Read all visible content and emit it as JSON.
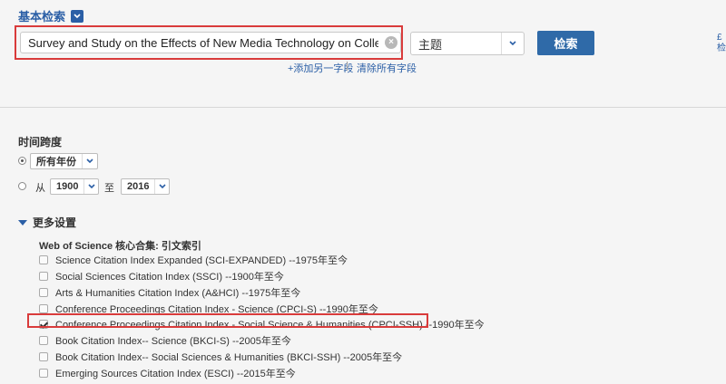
{
  "header": {
    "basic_search_label": "基本检索"
  },
  "search": {
    "query_value": "Survey and Study on the Effects of New Media Technology on College Studen",
    "field_selected": "主题",
    "search_button_label": "检索",
    "add_field_link": "+添加另一字段",
    "clear_fields_link": "清除所有字段",
    "right_edge_text": "£\n检"
  },
  "timespan": {
    "title": "时间跨度",
    "all_years_label": "所有年份",
    "from_label": "从",
    "from_year": "1900",
    "to_label": "至",
    "to_year": "2016",
    "selected": "all_years"
  },
  "more_settings": {
    "label": "更多设置",
    "wos_title": "Web of Science 核心合集: 引文索引",
    "indexes": [
      {
        "label": "Science Citation Index Expanded (SCI-EXPANDED) --1975年至今",
        "checked": false
      },
      {
        "label": "Social Sciences Citation Index (SSCI) --1900年至今",
        "checked": false
      },
      {
        "label": "Arts & Humanities Citation Index (A&HCI) --1975年至今",
        "checked": false
      },
      {
        "label": "Conference Proceedings Citation Index - Science (CPCI-S) --1990年至今",
        "checked": false
      },
      {
        "label": "Conference Proceedings Citation Index - Social Science & Humanities (CPCI-SSH) --1990年至今",
        "checked": true
      },
      {
        "label": "Book Citation Index-- Science (BKCI-S) --2005年至今",
        "checked": false
      },
      {
        "label": "Book Citation Index-- Social Sciences & Humanities (BKCI-SSH) --2005年至今",
        "checked": false
      },
      {
        "label": "Emerging Sources Citation Index (ESCI) --2015年至今",
        "checked": false
      }
    ]
  },
  "colors": {
    "accent": "#2b5fa6",
    "button": "#2f6aa8",
    "highlight": "#d93b3b",
    "background": "#f5f5f5"
  }
}
